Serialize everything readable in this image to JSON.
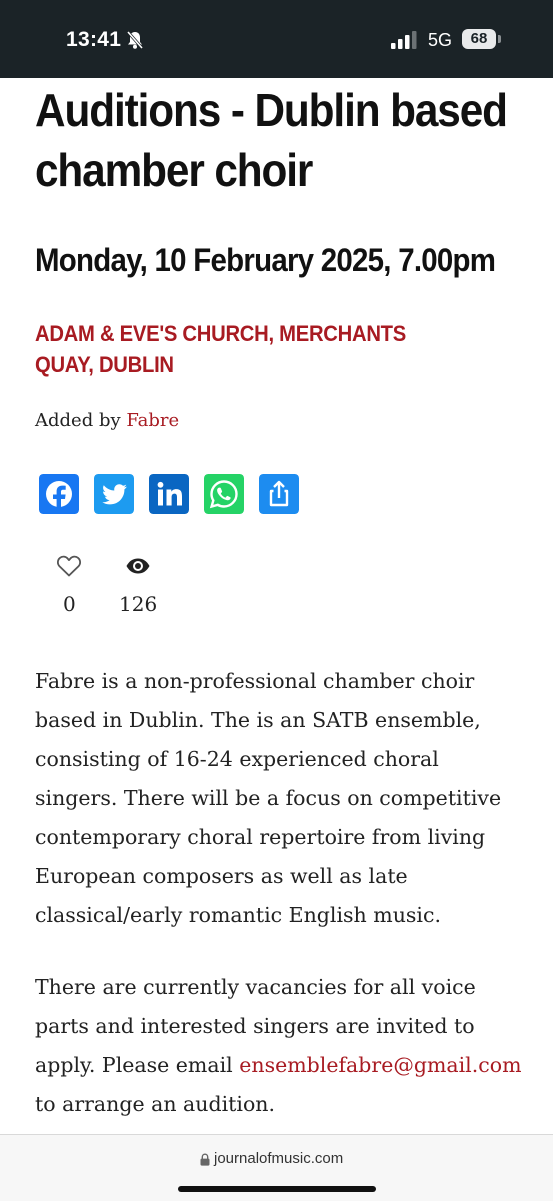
{
  "status_bar": {
    "time": "13:41",
    "network": "5G",
    "battery": "68"
  },
  "article": {
    "title": "Auditions - Dublin based chamber choir",
    "date": "Monday, 10 February 2025, 7.00pm",
    "venue": "ADAM & EVE'S CHURCH, MERCHANTS QUAY, DUBLIN",
    "added_by_prefix": "Added by",
    "added_by_user": "Fabre",
    "share_icons": [
      "facebook-icon",
      "twitter-icon",
      "linkedin-icon",
      "whatsapp-icon",
      "share-icon"
    ],
    "likes": "0",
    "views": "126",
    "paragraph1": "Fabre is a non-professional chamber choir based in Dublin. The is an SATB ensemble, consisting of 16-24 experienced choral singers. There will be a focus on competitive contemporary choral repertoire from living European composers as well as late classical/early romantic English music.",
    "paragraph2_before": "There are currently vacancies for all voice parts and interested singers are invited to apply. Please email",
    "paragraph2_email": "ensemblefabre@gmail.com",
    "paragraph2_after": "to arrange an audition."
  },
  "browser": {
    "url": "journalofmusic.com"
  },
  "colors": {
    "accent": "#a81b22",
    "status_bar_bg": "#1b2327",
    "facebook": "#1877f2",
    "twitter": "#1d9bf0",
    "linkedin": "#0a66c2",
    "whatsapp": "#25d366",
    "share": "#1d8cf0"
  }
}
